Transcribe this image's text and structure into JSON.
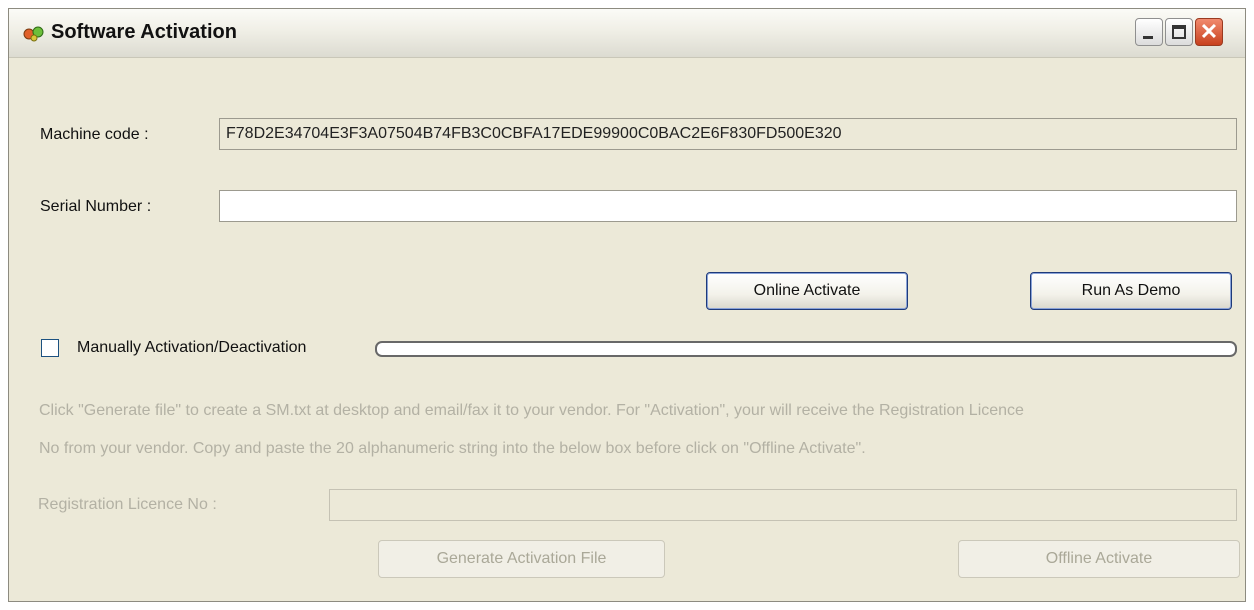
{
  "window": {
    "title": "Software Activation",
    "controls": {
      "minimize": "minimize",
      "maximize": "maximize",
      "close": "✕"
    }
  },
  "machine_code": {
    "label": "Machine code :",
    "value": "F78D2E34704E3F3A07504B74FB3C0CBFA17EDE99900C0BAC2E6F830FD500E320"
  },
  "serial_number": {
    "label": "Serial Number :",
    "value": ""
  },
  "buttons": {
    "online_activate": "Online Activate",
    "run_as_demo": "Run As Demo",
    "generate_activation_file": "Generate Activation File",
    "offline_activate": "Offline Activate"
  },
  "manual": {
    "checkbox_label": "Manually Activation/Deactivation",
    "checked": false
  },
  "progress": {
    "value": 0
  },
  "instructions": {
    "line1": "Click \"Generate file\" to create a SM.txt at desktop and email/fax it to your vendor.  For \"Activation\", your will receive the Registration Licence",
    "line2": " No from your vendor.  Copy and paste the 20 alphanumeric string into the below box before click on \"Offline Activate\"."
  },
  "registration": {
    "label": "Registration Licence No :",
    "value": ""
  }
}
